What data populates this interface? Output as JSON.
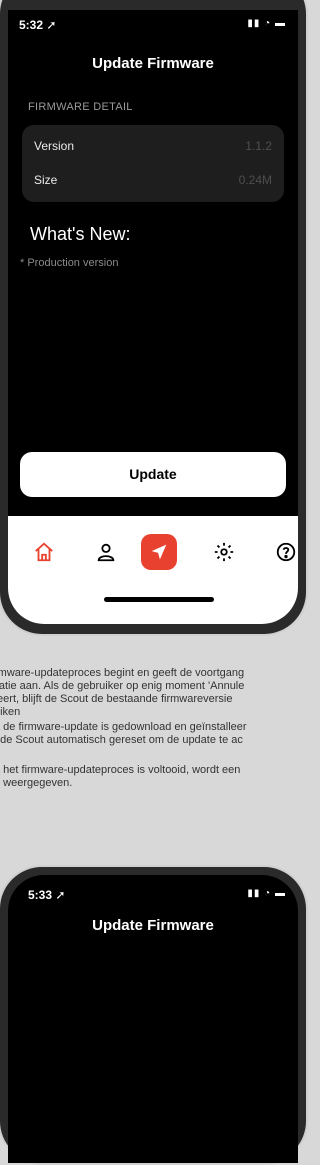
{
  "phone1": {
    "status": {
      "time": "5:32 ➚",
      "icons": "▮▮ ◔ ▬"
    },
    "title": "Update Firmware",
    "section_header": "FIRMWARE DETAIL",
    "details": [
      {
        "key": "Version",
        "value": "1.1.2"
      },
      {
        "key": "Size",
        "value": "0.24M"
      }
    ],
    "whats_new_title": "What's New:",
    "whats_new_note": "* Production version",
    "update_label": "Update",
    "tabbar": {
      "items": [
        {
          "name": "home-icon",
          "active": true
        },
        {
          "name": "user-icon"
        },
        {
          "name": "navigation-icon"
        },
        {
          "name": "settings-icon"
        },
        {
          "name": "help-icon"
        }
      ]
    }
  },
  "doc_text": {
    "p1_lines": [
      "rmware-updateproces begint en geeft de voortgang",
      "llatie aan. Als de gebruiker op enig moment 'Annule",
      "teert, blijft de Scout de bestaande firmwareversie",
      "uiken"
    ],
    "p2_lines": [
      "a de firmware-update is gedownload en geïnstalleer",
      "t de Scout automatisch gereset om de update te ac"
    ],
    "p3_lines": [
      "a het firmware-updateproces is voltooid, wordt een",
      "e weergegeven."
    ]
  },
  "phone2": {
    "status": {
      "time": "5:33 ➚",
      "icons": "▮▮ ◔ ▬"
    },
    "title": "Update Firmware"
  },
  "colors": {
    "accent": "#e8412f",
    "card": "#1e1e1e"
  }
}
